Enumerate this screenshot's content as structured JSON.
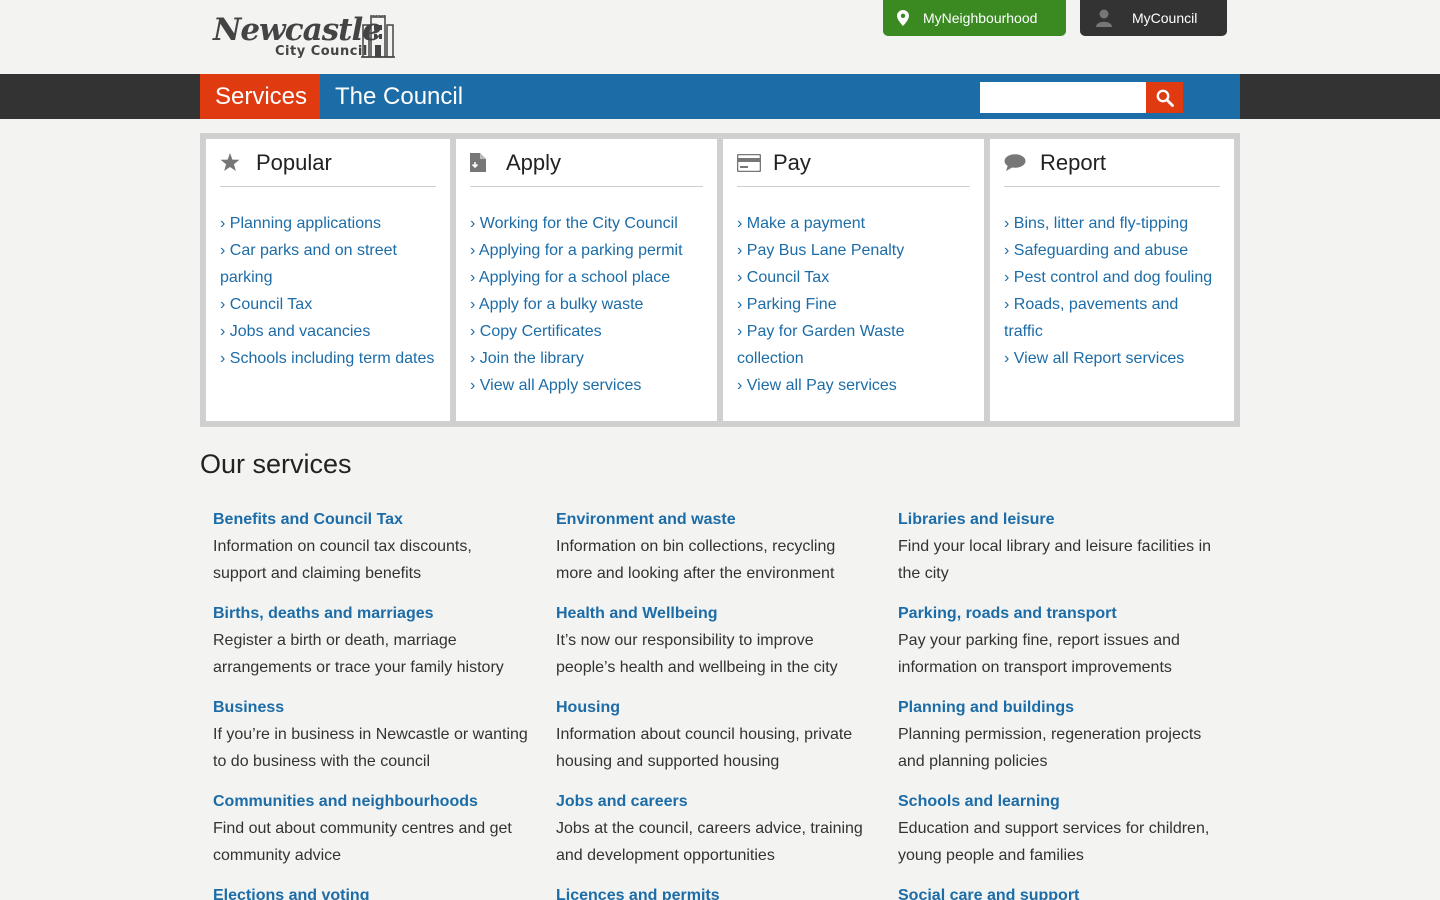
{
  "header": {
    "logo_main": "Newcastle",
    "logo_sub": "City Council",
    "my_neighbourhood": "MyNeighbourhood",
    "my_council": "MyCouncil"
  },
  "nav": {
    "services": "Services",
    "council": "The Council",
    "search_placeholder": ""
  },
  "colors": {
    "brand_blue": "#1c6ca7",
    "accent_red": "#e03a10",
    "neighbourhood_green": "#3a8a21"
  },
  "tasks": [
    {
      "title": "Popular",
      "icon": "star-icon",
      "links": [
        "Planning applications",
        "Car parks and on street parking",
        "Council Tax",
        "Jobs and vacancies",
        "Schools including term dates"
      ]
    },
    {
      "title": "Apply",
      "icon": "document-icon",
      "links": [
        "Working for the City Council",
        "Applying for a parking permit",
        "Applying for a school place",
        "Apply for a bulky waste",
        "Copy Certificates",
        "Join the library",
        "View all Apply services"
      ]
    },
    {
      "title": "Pay",
      "icon": "credit-card-icon",
      "links": [
        "Make a payment",
        "Pay Bus Lane Penalty",
        "Council Tax",
        "Parking Fine",
        "Pay for Garden Waste collection",
        "View all Pay services"
      ]
    },
    {
      "title": "Report",
      "icon": "speech-bubble-icon",
      "links": [
        "Bins, litter and fly-tipping",
        "Safeguarding and abuse",
        "Pest control and dog fouling",
        "Roads, pavements and traffic",
        "View all Report services"
      ]
    }
  ],
  "services": {
    "title": "Our services",
    "items": [
      {
        "title": "Benefits and Council Tax",
        "desc": "Information on council tax discounts, support and claiming benefits"
      },
      {
        "title": "Environment and waste",
        "desc": "Information on bin collections, recycling more and looking after the environment"
      },
      {
        "title": "Libraries and leisure",
        "desc": "Find your local library and leisure facilities in the city"
      },
      {
        "title": "Births, deaths and marriages",
        "desc": "Register a birth or death, marriage arrangements or trace your family history"
      },
      {
        "title": "Health and Wellbeing",
        "desc": "It’s now our responsibility to improve people’s health and wellbeing in the city"
      },
      {
        "title": "Parking, roads and transport",
        "desc": "Pay your parking fine, report issues and information on transport improvements"
      },
      {
        "title": "Business",
        "desc": "If you’re in business in Newcastle or wanting to do business with the council"
      },
      {
        "title": "Housing",
        "desc": "Information about council housing, private housing and supported housing"
      },
      {
        "title": "Planning and buildings",
        "desc": "Planning permission, regeneration projects and planning policies"
      },
      {
        "title": "Communities and neighbourhoods",
        "desc": "Find out about community centres and get community advice"
      },
      {
        "title": "Jobs and careers",
        "desc": "Jobs at the council, careers advice, training and development opportunities"
      },
      {
        "title": "Schools and learning",
        "desc": "Education and support services for children, young people and families"
      },
      {
        "title": "Elections and voting",
        "desc": ""
      },
      {
        "title": "Licences and permits",
        "desc": ""
      },
      {
        "title": "Social care and support",
        "desc": ""
      }
    ]
  }
}
